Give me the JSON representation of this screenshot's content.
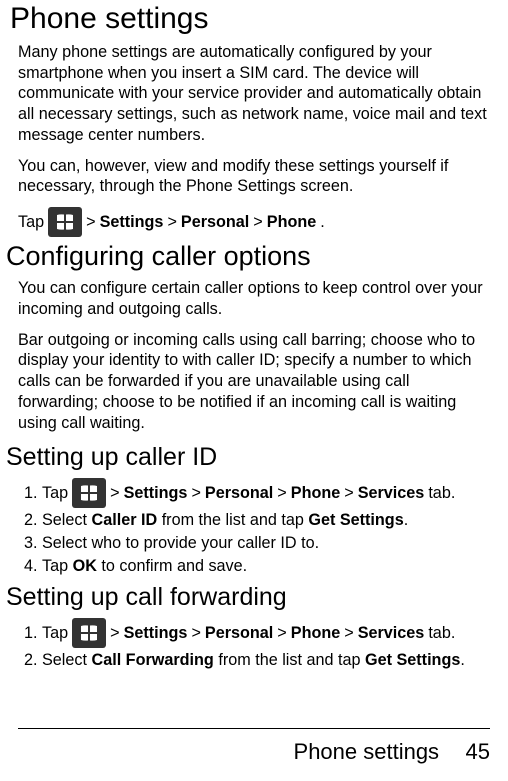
{
  "headings": {
    "h1": "Phone settings",
    "h2": "Configuring caller options",
    "h3a": "Setting up caller ID",
    "h3b": "Setting up call forwarding"
  },
  "paragraphs": {
    "p1": "Many phone settings are automatically configured by your smartphone when you insert a SIM card. The device will communicate with your service provider and automatically obtain all necessary settings, such as network name, voice mail and text message center numbers.",
    "p2": "You can, however, view and modify these settings yourself if necessary, through the Phone Settings screen.",
    "p3": "You can configure certain caller options to keep control over your incoming and outgoing calls.",
    "p4": "Bar outgoing or incoming calls using call barring; choose who to display your identity to with caller ID; specify a number to which calls can be forwarded if you are unavailable using call forwarding; choose to be notified if an incoming call is waiting using call waiting."
  },
  "nav": {
    "tap": "Tap",
    "gt": ">",
    "settings": "Settings",
    "personal": "Personal",
    "phone": "Phone",
    "services": "Services",
    "tab": "tab.",
    "period": "."
  },
  "steps": {
    "callerID": {
      "s1_prefix": "Tap",
      "s2_prefix": "Select",
      "s2_bold": "Caller ID",
      "s2_mid": "from the list and tap",
      "s2_bold2": "Get Settings",
      "s2_end": ".",
      "s3": "Select who to provide your caller ID to.",
      "s4_prefix": "Tap",
      "s4_bold": "OK",
      "s4_end": "to confirm and save."
    },
    "callFwd": {
      "s1_prefix": "Tap",
      "s2_prefix": "Select",
      "s2_bold": "Call Forwarding",
      "s2_mid": "from the list and tap",
      "s2_bold2": "Get Settings",
      "s2_end": "."
    }
  },
  "footer": {
    "title": "Phone settings",
    "page": "45"
  }
}
